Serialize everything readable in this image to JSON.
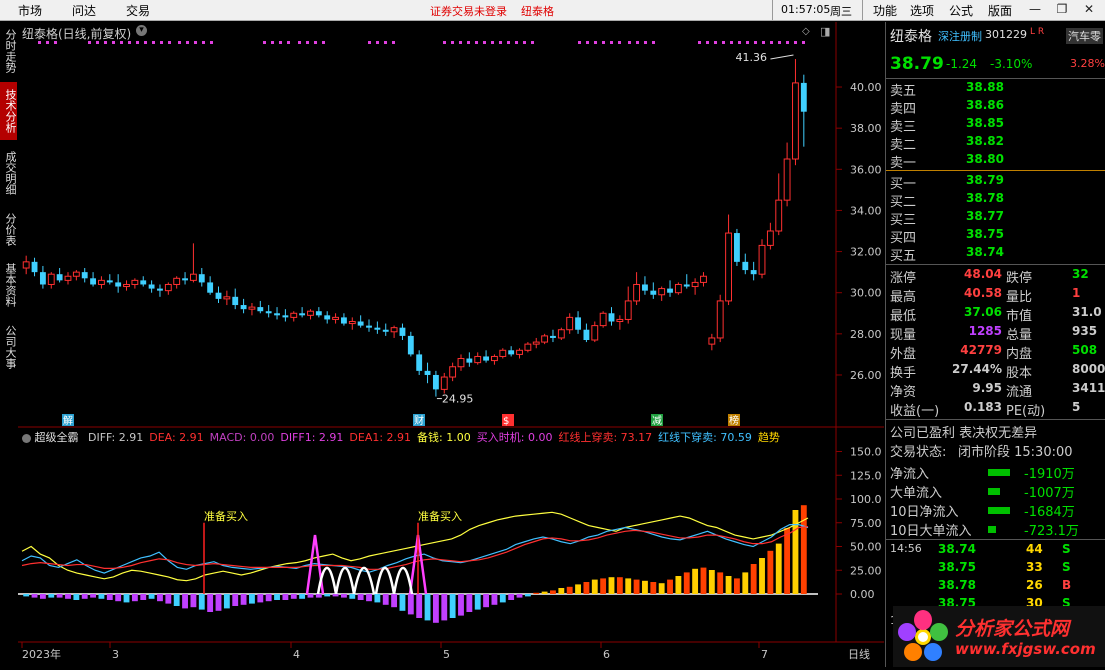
{
  "menu": {
    "items": [
      "市场",
      "问达",
      "交易"
    ],
    "warning": "证券交易未登录",
    "stock_link": "纽泰格",
    "time": "01:57:05",
    "weekday": "周三",
    "right_items": [
      "功能",
      "选项",
      "公式",
      "版面"
    ]
  },
  "side_tabs": [
    "分时走势",
    "技术分析",
    "成交明细",
    "分价表",
    "基本资料",
    "公司大事"
  ],
  "chart_title": "纽泰格(日线,前复权)",
  "price_axis": [
    "40.00",
    "38.00",
    "36.00",
    "34.00",
    "32.00",
    "30.00",
    "28.00",
    "26.00"
  ],
  "price_marks": {
    "high": "41.36",
    "low": "24.95"
  },
  "signals": [
    "解",
    "财",
    "$",
    "减",
    "榜"
  ],
  "indicator": {
    "name": "超级全霸",
    "items": [
      {
        "label": "DIFF: 2.91",
        "color": "#c8c8c8"
      },
      {
        "label": "DEA: 2.91",
        "color": "#ff3030"
      },
      {
        "label": "MACD: 0.00",
        "color": "#c040c0"
      },
      {
        "label": "DIFF1: 2.91",
        "color": "#e040e0"
      },
      {
        "label": "DEA1: 2.91",
        "color": "#ff3030"
      },
      {
        "label": "备钱: 1.00",
        "color": "#ffff40"
      },
      {
        "label": "买入时机: 0.00",
        "color": "#e040e0"
      },
      {
        "label": "红线上穿卖: 73.17",
        "color": "#ff3030"
      },
      {
        "label": "红线下穿卖: 70.59",
        "color": "#40c0ff"
      },
      {
        "label": "趋势",
        "color": "#ffd700"
      }
    ],
    "annotations": [
      "准备买入",
      "准备买入"
    ]
  },
  "indicator_axis": [
    "150.0",
    "125.0",
    "100.0",
    "75.00",
    "50.00",
    "25.00",
    "0.00"
  ],
  "date_axis": [
    "2023年",
    "3",
    "4",
    "5",
    "6",
    "7"
  ],
  "period": "日线",
  "quote": {
    "name": "纽泰格",
    "tag": "深注册制",
    "code": "301229",
    "lr": "L R",
    "sector": "汽车零",
    "sector_pct": "3.28%",
    "price": "38.79",
    "change": "-1.24",
    "pct": "-3.10%",
    "asks": [
      [
        "卖五",
        "38.88"
      ],
      [
        "卖四",
        "38.86"
      ],
      [
        "卖三",
        "38.85"
      ],
      [
        "卖二",
        "38.82"
      ],
      [
        "卖一",
        "38.80"
      ]
    ],
    "bids": [
      [
        "买一",
        "38.79"
      ],
      [
        "买二",
        "38.78"
      ],
      [
        "买三",
        "38.77"
      ],
      [
        "买四",
        "38.75"
      ],
      [
        "买五",
        "38.74"
      ]
    ],
    "stats": [
      [
        "涨停",
        "48.04",
        "跌停",
        "32"
      ],
      [
        "最高",
        "40.58",
        "量比",
        "1"
      ],
      [
        "最低",
        "37.06",
        "市值",
        "31.0"
      ],
      [
        "现量",
        "1285",
        "总量",
        "935"
      ],
      [
        "外盘",
        "42779",
        "内盘",
        "508"
      ],
      [
        "换手",
        "27.44%",
        "股本",
        "8000"
      ],
      [
        "净资",
        "9.95",
        "流通",
        "3411"
      ],
      [
        "收益(一)",
        "0.183",
        "PE(动)",
        "5"
      ]
    ],
    "company": "公司已盈利 表决权无差异",
    "trade_status_label": "交易状态:",
    "trade_status": "闭市阶段 15:30:00",
    "flows": [
      [
        "净流入",
        "-1910万"
      ],
      [
        "大单流入",
        "-1007万"
      ],
      [
        "10日净流入",
        "-1684万"
      ],
      [
        "10日大单流入",
        "-723.1万"
      ]
    ],
    "ticks": [
      [
        "14:56",
        "38.74",
        "44",
        "S"
      ],
      [
        "",
        "38.75",
        "33",
        "S"
      ],
      [
        "",
        "38.78",
        "26",
        "B"
      ],
      [
        "",
        "38.75",
        "30",
        "S"
      ],
      [
        "1",
        "",
        " ",
        ""
      ]
    ]
  },
  "logo": {
    "text": "分析家公式网",
    "url": "www.fxjgsw.com"
  },
  "candles": [
    [
      31.2,
      31.8,
      30.9,
      31.5
    ],
    [
      31.5,
      31.7,
      30.8,
      31.0
    ],
    [
      31.0,
      31.3,
      30.2,
      30.4
    ],
    [
      30.4,
      31.0,
      30.2,
      30.9
    ],
    [
      30.9,
      31.2,
      30.5,
      30.6
    ],
    [
      30.6,
      31.0,
      30.4,
      30.8
    ],
    [
      30.8,
      31.1,
      30.6,
      31.0
    ],
    [
      31.0,
      31.2,
      30.5,
      30.7
    ],
    [
      30.7,
      31.0,
      30.3,
      30.4
    ],
    [
      30.4,
      30.8,
      30.2,
      30.6
    ],
    [
      30.6,
      30.9,
      30.4,
      30.5
    ],
    [
      30.5,
      30.9,
      30.0,
      30.3
    ],
    [
      30.3,
      30.6,
      30.1,
      30.4
    ],
    [
      30.4,
      30.7,
      30.2,
      30.6
    ],
    [
      30.6,
      30.8,
      30.3,
      30.4
    ],
    [
      30.4,
      30.6,
      30.0,
      30.2
    ],
    [
      30.2,
      30.4,
      29.8,
      30.1
    ],
    [
      30.1,
      30.5,
      29.9,
      30.4
    ],
    [
      30.4,
      30.8,
      30.2,
      30.7
    ],
    [
      30.7,
      31.0,
      30.4,
      30.6
    ],
    [
      30.6,
      32.4,
      30.5,
      30.9
    ],
    [
      30.9,
      31.2,
      30.3,
      30.5
    ],
    [
      30.5,
      30.8,
      29.9,
      30.0
    ],
    [
      30.0,
      30.3,
      29.5,
      29.7
    ],
    [
      29.7,
      30.1,
      29.4,
      29.8
    ],
    [
      29.8,
      30.2,
      29.2,
      29.4
    ],
    [
      29.4,
      29.7,
      29.0,
      29.2
    ],
    [
      29.2,
      29.5,
      28.9,
      29.3
    ],
    [
      29.3,
      29.6,
      29.0,
      29.1
    ],
    [
      29.1,
      29.4,
      28.8,
      29.0
    ],
    [
      29.0,
      29.3,
      28.7,
      28.9
    ],
    [
      28.9,
      29.2,
      28.6,
      28.8
    ],
    [
      28.8,
      29.1,
      28.6,
      29.0
    ],
    [
      29.0,
      29.3,
      28.8,
      28.9
    ],
    [
      28.9,
      29.2,
      28.7,
      29.1
    ],
    [
      29.1,
      29.3,
      28.8,
      28.9
    ],
    [
      28.9,
      29.1,
      28.5,
      28.7
    ],
    [
      28.7,
      29.0,
      28.5,
      28.8
    ],
    [
      28.8,
      29.0,
      28.4,
      28.5
    ],
    [
      28.5,
      28.8,
      28.2,
      28.6
    ],
    [
      28.6,
      28.9,
      28.3,
      28.4
    ],
    [
      28.4,
      28.7,
      28.1,
      28.3
    ],
    [
      28.3,
      28.6,
      28.0,
      28.2
    ],
    [
      28.2,
      28.5,
      27.9,
      28.1
    ],
    [
      28.1,
      28.4,
      27.8,
      28.3
    ],
    [
      28.3,
      28.5,
      27.7,
      27.9
    ],
    [
      27.9,
      28.1,
      26.9,
      27.0
    ],
    [
      27.0,
      27.2,
      26.0,
      26.2
    ],
    [
      26.2,
      26.6,
      25.6,
      26.0
    ],
    [
      26.0,
      26.2,
      24.95,
      25.3
    ],
    [
      25.3,
      26.1,
      25.1,
      25.9
    ],
    [
      25.9,
      26.6,
      25.7,
      26.4
    ],
    [
      26.4,
      27.0,
      26.2,
      26.8
    ],
    [
      26.8,
      27.1,
      26.4,
      26.6
    ],
    [
      26.6,
      27.1,
      26.5,
      26.9
    ],
    [
      26.9,
      27.2,
      26.6,
      26.7
    ],
    [
      26.7,
      27.0,
      26.5,
      26.9
    ],
    [
      26.9,
      27.3,
      26.8,
      27.2
    ],
    [
      27.2,
      27.4,
      26.9,
      27.0
    ],
    [
      27.0,
      27.3,
      26.8,
      27.2
    ],
    [
      27.2,
      27.6,
      27.1,
      27.5
    ],
    [
      27.5,
      27.8,
      27.3,
      27.6
    ],
    [
      27.6,
      28.0,
      27.5,
      27.9
    ],
    [
      27.9,
      28.2,
      27.6,
      27.8
    ],
    [
      27.8,
      28.3,
      27.7,
      28.2
    ],
    [
      28.2,
      29.0,
      28.0,
      28.8
    ],
    [
      28.8,
      29.1,
      28.0,
      28.2
    ],
    [
      28.2,
      28.5,
      27.6,
      27.7
    ],
    [
      27.7,
      28.6,
      27.6,
      28.4
    ],
    [
      28.4,
      29.1,
      28.3,
      29.0
    ],
    [
      29.0,
      29.3,
      28.4,
      28.6
    ],
    [
      28.6,
      28.9,
      28.2,
      28.7
    ],
    [
      28.7,
      30.3,
      28.5,
      29.6
    ],
    [
      29.6,
      31.0,
      29.4,
      30.4
    ],
    [
      30.4,
      30.8,
      29.9,
      30.1
    ],
    [
      30.1,
      30.5,
      29.7,
      29.9
    ],
    [
      29.9,
      30.3,
      29.6,
      30.2
    ],
    [
      30.2,
      30.6,
      29.8,
      30.0
    ],
    [
      30.0,
      30.5,
      29.9,
      30.4
    ],
    [
      30.4,
      30.9,
      30.2,
      30.3
    ],
    [
      30.3,
      30.7,
      29.9,
      30.5
    ],
    [
      30.5,
      31.0,
      30.3,
      30.8
    ],
    [
      27.5,
      28.0,
      27.2,
      27.8
    ],
    [
      27.8,
      29.9,
      27.6,
      29.6
    ],
    [
      29.6,
      33.8,
      29.4,
      32.9
    ],
    [
      32.9,
      33.1,
      31.3,
      31.5
    ],
    [
      31.5,
      31.9,
      30.9,
      31.1
    ],
    [
      31.1,
      31.5,
      30.6,
      30.9
    ],
    [
      30.9,
      32.6,
      30.7,
      32.3
    ],
    [
      32.3,
      33.4,
      32.1,
      33.0
    ],
    [
      33.0,
      35.8,
      32.8,
      34.5
    ],
    [
      34.5,
      37.3,
      34.2,
      36.5
    ],
    [
      36.5,
      41.36,
      36.2,
      40.2
    ],
    [
      40.2,
      40.6,
      37.1,
      38.8
    ]
  ],
  "macd_bars": [
    -2,
    -3,
    -4,
    -3,
    -3,
    -4,
    -5,
    -4,
    -3,
    -4,
    -5,
    -6,
    -7,
    -6,
    -5,
    -4,
    -6,
    -8,
    -10,
    -12,
    -11,
    -13,
    -15,
    -14,
    -12,
    -10,
    -9,
    -8,
    -7,
    -6,
    -5,
    -5,
    -4,
    -4,
    -3,
    -3,
    -2,
    -2,
    -3,
    -4,
    -5,
    -6,
    -7,
    -9,
    -11,
    -14,
    -17,
    -20,
    -22,
    -24,
    -22,
    -20,
    -18,
    -15,
    -13,
    -11,
    -9,
    -7,
    -5,
    -3,
    -2,
    1,
    2,
    3,
    5,
    6,
    8,
    10,
    12,
    13,
    14,
    14,
    13,
    12,
    11,
    10,
    9,
    12,
    15,
    18,
    21,
    22,
    20,
    18,
    15,
    13,
    18,
    25,
    30,
    36,
    42,
    55,
    70,
    74
  ],
  "vol_lines": {
    "diff": [
      35,
      40,
      38,
      30,
      28,
      32,
      36,
      30,
      25,
      22,
      26,
      30,
      34,
      38,
      40,
      44,
      35,
      28,
      26,
      30,
      32,
      34,
      30,
      28,
      27,
      26,
      27,
      28,
      29,
      28,
      27,
      30,
      32,
      31,
      30,
      29,
      28,
      25,
      23,
      26,
      30,
      33,
      37,
      40,
      42,
      38,
      35,
      34,
      33,
      35,
      38,
      41,
      44,
      47,
      52,
      55,
      58,
      60,
      58,
      55,
      53,
      56,
      60,
      62,
      66,
      68,
      70,
      68,
      66,
      63,
      60,
      58,
      57,
      60,
      63,
      66,
      62,
      58,
      55,
      52,
      50,
      55,
      60,
      68,
      73,
      73,
      70
    ],
    "dea": [
      30,
      32,
      33,
      32,
      31,
      30,
      31,
      31,
      29,
      27,
      27,
      28,
      30,
      33,
      35,
      37,
      36,
      33,
      31,
      30,
      31,
      32,
      31,
      30,
      29,
      28,
      28,
      28,
      28,
      28,
      28,
      29,
      30,
      30,
      30,
      30,
      29,
      28,
      26,
      26,
      27,
      29,
      31,
      34,
      36,
      37,
      36,
      35,
      34,
      35,
      36,
      38,
      41,
      44,
      48,
      52,
      55,
      58,
      59,
      58,
      56,
      56,
      57,
      59,
      62,
      64,
      66,
      67,
      66,
      65,
      63,
      61,
      59,
      59,
      60,
      62,
      62,
      60,
      58,
      55,
      53,
      53,
      55,
      60,
      64,
      70,
      71
    ],
    "yellow": [
      45,
      50,
      42,
      38,
      30,
      25,
      22,
      20,
      18,
      16,
      18,
      22,
      25,
      24,
      22,
      20,
      18,
      15,
      14,
      16,
      20,
      22,
      24,
      22,
      20,
      22,
      25,
      28,
      30,
      32,
      33,
      35,
      38,
      40,
      42,
      38,
      35,
      37,
      40,
      42,
      44,
      46,
      48,
      50,
      52,
      54,
      56,
      58,
      62,
      68,
      72,
      75,
      78,
      80,
      82,
      83,
      84,
      85,
      86,
      84,
      80,
      76,
      72,
      70,
      68,
      66,
      70,
      72,
      74,
      76,
      78,
      80,
      82,
      80,
      76,
      72,
      70,
      66,
      62,
      60,
      58,
      60,
      62,
      66,
      70,
      75,
      80
    ]
  }
}
